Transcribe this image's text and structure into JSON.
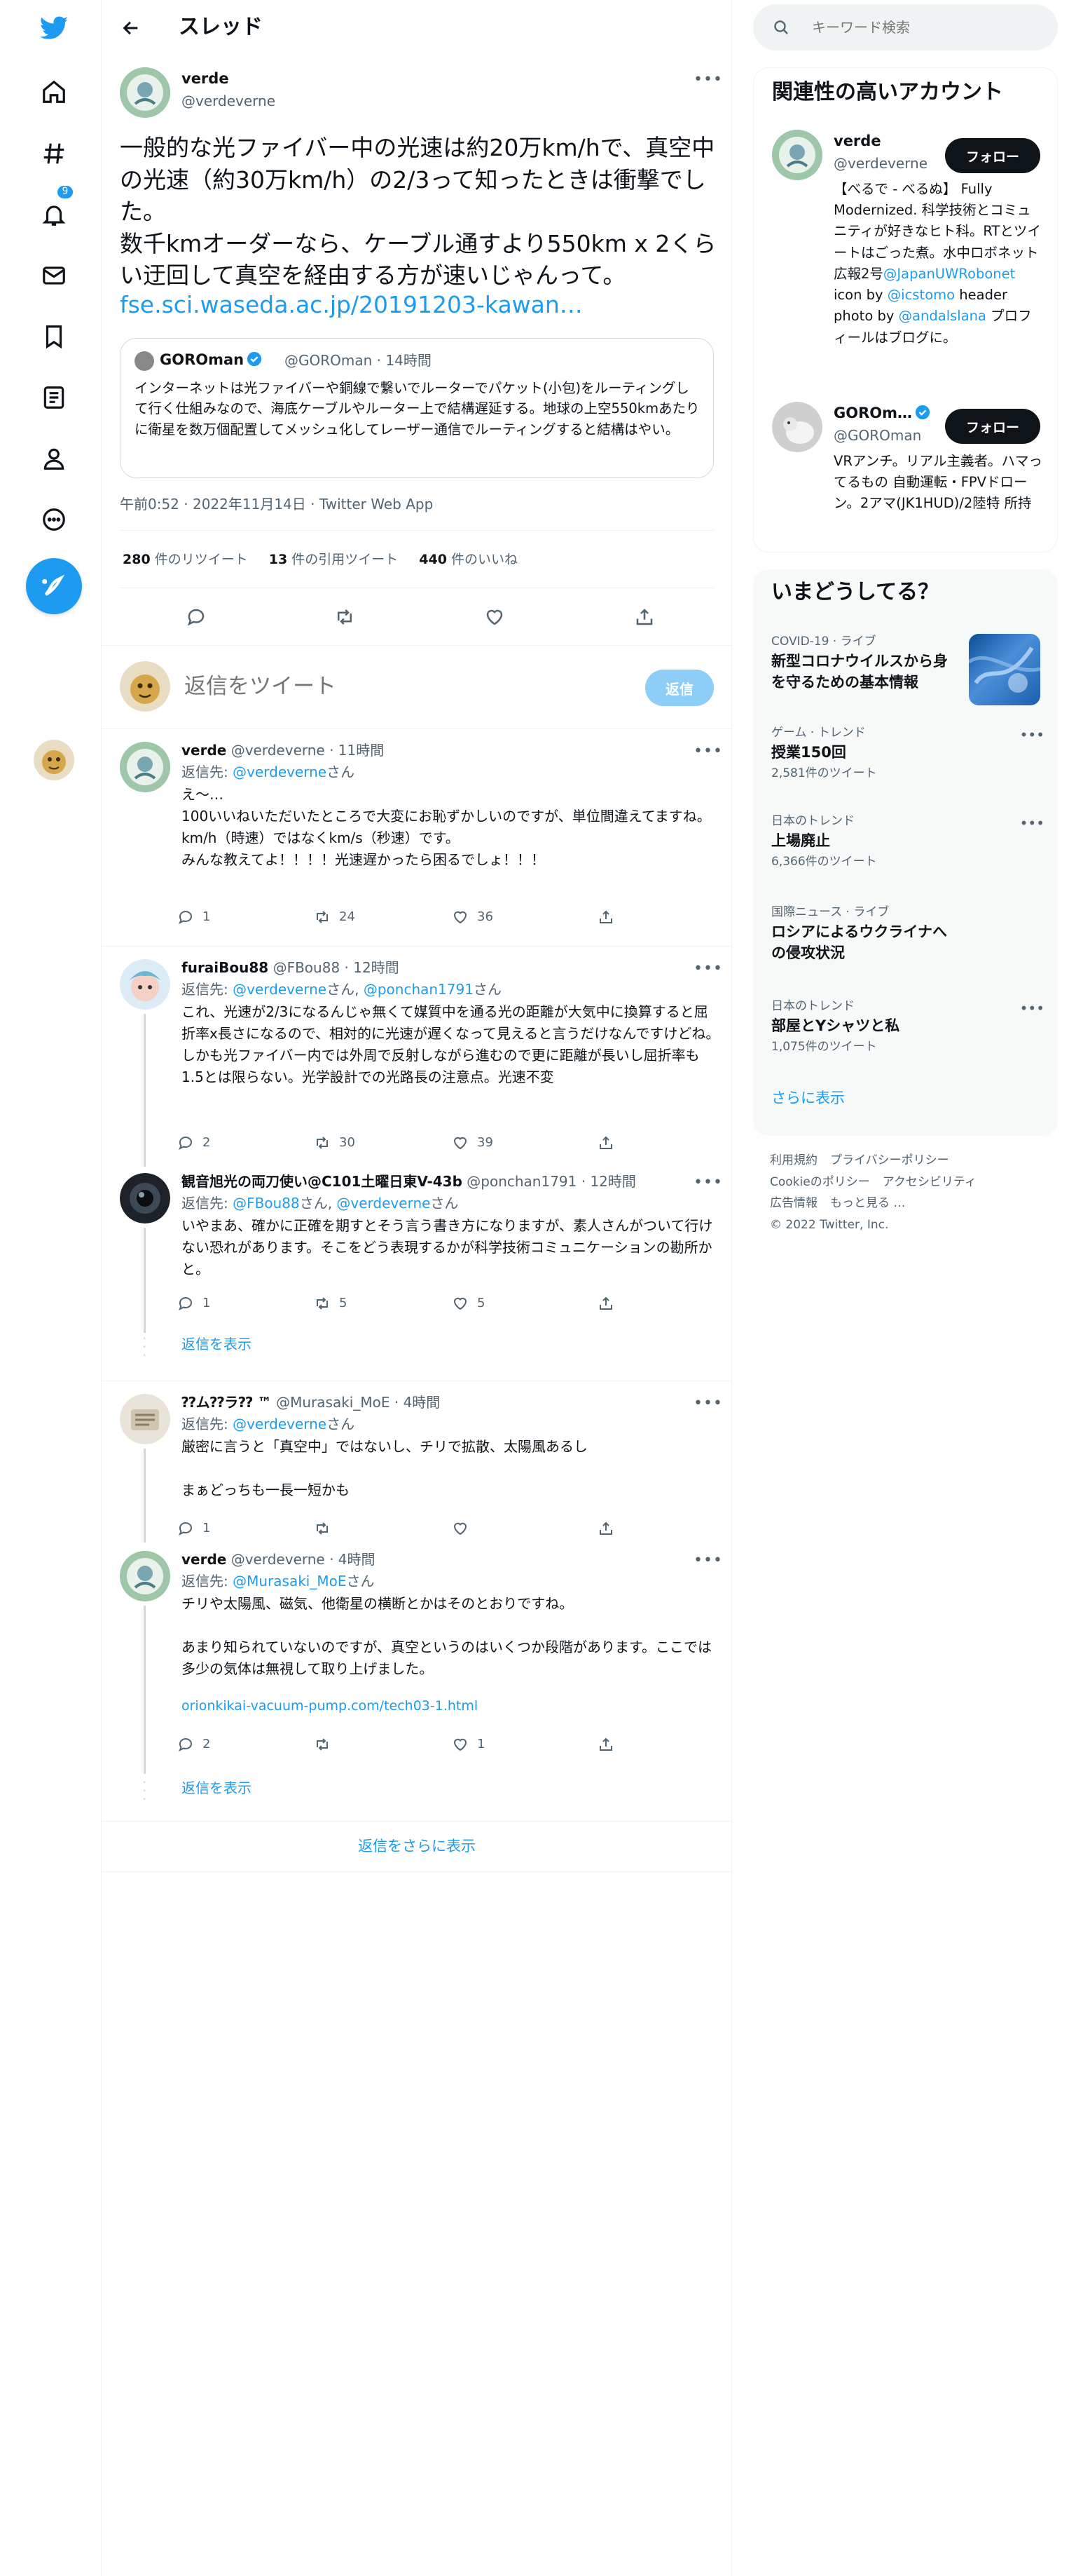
{
  "nav": {
    "notification_count": "9",
    "items": [
      "home-icon",
      "explore-icon",
      "notifications-icon",
      "messages-icon",
      "bookmarks-icon",
      "lists-icon",
      "profile-icon",
      "more-icon"
    ]
  },
  "header": {
    "title": "スレッド"
  },
  "main_tweet": {
    "name": "verde",
    "handle": "@verdeverne",
    "text": "一般的な光ファイバー中の光速は約20万km/hで、真空中の光速（約30万km/h）の2/3って知ったときは衝撃でした。\n数千kmオーダーなら、ケーブル通すより550km x 2くらい迂回して真空を経由する方が速いじゃんって。",
    "link": "fse.sci.waseda.ac.jp/20191203-kawan…",
    "quote": {
      "name": "GOROman",
      "handle": "@GOROman · 14時間",
      "text": "インターネットは光ファイバーや銅線で繋いでルーターでパケット(小包)をルーティングして行く仕組みなので、海底ケーブルやルーター上で結構遅延する。地球の上空550kmあたりに衛星を数万個配置してメッシュ化してレーザー通信でルーティングすると結構はやい。"
    },
    "timestamp": "午前0:52 · 2022年11月14日 · Twitter Web App",
    "stats": {
      "retweets": "280",
      "retweets_label": "件のリツイート",
      "quotes": "13",
      "quotes_label": "件の引用ツイート",
      "likes": "440",
      "likes_label": "件のいいね"
    }
  },
  "reply_box": {
    "placeholder": "返信をツイート",
    "button": "返信"
  },
  "replies": [
    {
      "name": "verde",
      "handle": "@verdeverne · 11時間",
      "to_prefix": "返信先: ",
      "to": "@verdeverne",
      "to_suffix": "さん",
      "body": "え〜…\n100いいねいただいたところで大変にお恥ずかしいのですが、単位間違えてますね。\nkm/h（時速）ではなくkm/s（秒速）です。\nみんな教えてよ！！！！光速遅かったら困るでしょ！！！",
      "replies": "1",
      "retweets": "24",
      "likes": "36"
    },
    {
      "name": "furaiBou88",
      "handle": "@FBou88 · 12時間",
      "to_prefix": "返信先: ",
      "to": "@verdeverne",
      "to_mid": "さん, ",
      "to2": "@ponchan1791",
      "to_suffix": "さん",
      "body": "これ、光速が2/3になるんじゃ無くて媒質中を通る光の距離が大気中に換算すると屈折率x長さになるので、相対的に光速が遅くなって見えると言うだけなんですけどね。しかも光ファイバー内では外周で反射しながら進むので更に距離が長いし屈折率も1.5とは限らない。光学設計での光路長の注意点。光速不変",
      "replies": "2",
      "retweets": "30",
      "likes": "39"
    },
    {
      "name": "観音旭光の両刀使い@C101土曜日東V-43b",
      "handle": "@ponchan1791 · 12時間",
      "to_prefix": "返信先: ",
      "to": "@FBou88",
      "to_mid": "さん, ",
      "to2": "@verdeverne",
      "to_suffix": "さん",
      "body": "いやまあ、確かに正確を期すとそう言う書き方になりますが、素人さんがついて行けない恐れがあります。そこをどう表現するかが科学技術コミュニケーションの勘所かと。",
      "replies": "1",
      "retweets": "5",
      "likes": "5",
      "show_replies": "返信を表示"
    },
    {
      "name": "⁇ム⁇ラ⁇ ™",
      "handle": "@Murasaki_MoE · 4時間",
      "to_prefix": "返信先: ",
      "to": "@verdeverne",
      "to_suffix": "さん",
      "body": "厳密に言うと「真空中」ではないし、チリで拡散、太陽風あるし\n\nまぁどっちも一長一短かも",
      "replies": "1",
      "retweets": "",
      "likes": ""
    },
    {
      "name": "verde",
      "handle": "@verdeverne · 4時間",
      "to_prefix": "返信先: ",
      "to": "@Murasaki_MoE",
      "to_suffix": "さん",
      "body": "チリや太陽風、磁気、他衛星の横断とかはそのとおりですね。\n\nあまり知られていないのですが、真空というのはいくつか段階があります。ここでは多少の気体は無視して取り上げました。",
      "link": "orionkikai-vacuum-pump.com/tech03-1.html",
      "replies": "2",
      "retweets": "",
      "likes": "1",
      "show_replies": "返信を表示"
    }
  ],
  "more_replies": "返信をさらに表示",
  "sidebar": {
    "search_placeholder": "キーワード検索",
    "relevant_title": "関連性の高いアカウント",
    "accounts": [
      {
        "name": "verde",
        "handle": "@verdeverne",
        "follow": "フォロー",
        "bio_pre": "【べるで - べるぬ】 Fully Modernized. 科学技術とコミュニティが好きなヒト科。RTとツイートはごった煮。水中ロボネット広報2号",
        "bio_link1": "@JapanUWRobonet",
        "bio_mid1": " icon by ",
        "bio_link2": "@icstomo",
        "bio_mid2": " header photo by ",
        "bio_link3": "@andalslana",
        "bio_post": " プロフィールはブログに。"
      },
      {
        "name": "GOROm…",
        "handle": "@GOROman",
        "follow": "フォロー",
        "bio_pre": "VRアンチ。リアル主義者。ハマってるもの 自動運転・FPVドローン。2アマ(JK1HUD)/2陸特 所持"
      }
    ],
    "trends_title": "いまどうしてる？",
    "trends": [
      {
        "meta": "COVID-19 · ライブ",
        "name": "新型コロナウイルスから身を守るための基本情報",
        "count": ""
      },
      {
        "meta": "ゲーム · トレンド",
        "name": "授業150回",
        "count": "2,581件のツイート"
      },
      {
        "meta": "日本のトレンド",
        "name": "上場廃止",
        "count": "6,366件のツイート"
      },
      {
        "meta": "国際ニュース · ライブ",
        "name": "ロシアによるウクライナへの侵攻状況",
        "count": ""
      },
      {
        "meta": "日本のトレンド",
        "name": "部屋とYシャツと私",
        "count": "1,075件のツイート"
      }
    ],
    "show_more": "さらに表示",
    "footer": [
      "利用規約",
      "プライバシーポリシー",
      "Cookieのポリシー",
      "アクセシビリティ",
      "広告情報",
      "もっと見る …",
      "© 2022 Twitter, Inc."
    ]
  },
  "colors": {
    "accent": "#1d9bf0",
    "text": "#0f1419",
    "muted": "#536471",
    "border": "#eff3f4"
  }
}
